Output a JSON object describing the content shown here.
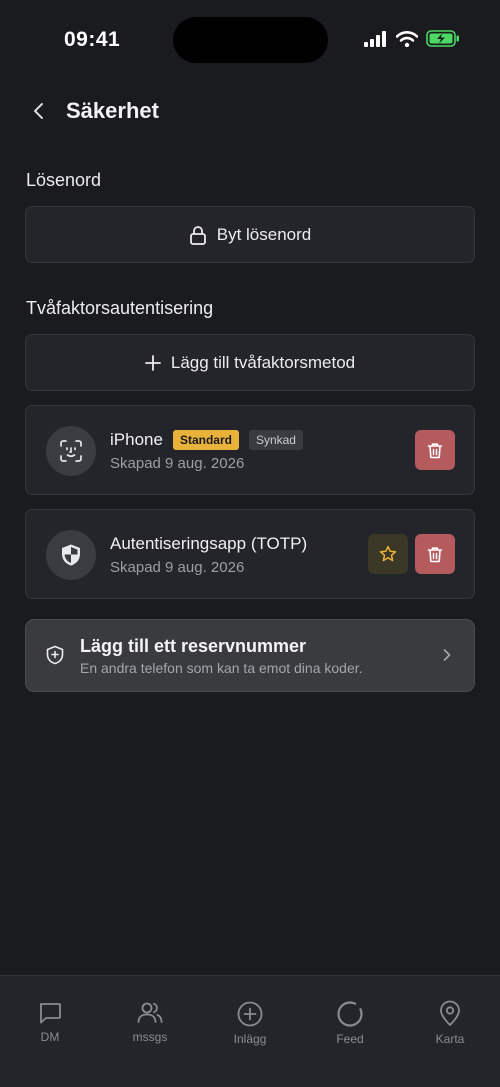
{
  "status_bar": {
    "time": "09:41"
  },
  "header": {
    "title": "Säkerhet"
  },
  "password_section": {
    "label": "Lösenord",
    "change_button": "Byt lösenord"
  },
  "two_factor_section": {
    "label": "Tvåfaktorsautentisering",
    "add_button": "Lägg till tvåfaktorsmetod",
    "methods": [
      {
        "name": "iPhone",
        "badge_default": "Standard",
        "badge_sync": "Synkad",
        "created": "Skapad 9 aug. 2026",
        "icon": "face-id-icon"
      },
      {
        "name": "Autentiseringsapp (TOTP)",
        "created": "Skapad 9 aug. 2026",
        "icon": "shield-icon"
      }
    ]
  },
  "backup_number": {
    "title": "Lägg till ett reservnummer",
    "subtitle": "En andra telefon som kan ta emot dina koder."
  },
  "tab_bar": {
    "tabs": [
      {
        "label": "DM",
        "icon": "chat-bubble-icon"
      },
      {
        "label": "mssgs",
        "icon": "users-icon"
      },
      {
        "label": "Inlägg",
        "icon": "plus-circle-icon"
      },
      {
        "label": "Feed",
        "icon": "circle-icon"
      },
      {
        "label": "Karta",
        "icon": "map-pin-icon"
      }
    ]
  },
  "colors": {
    "background": "#1a1b1e",
    "card": "#24252a",
    "badge_standard": "#e9b23a",
    "delete": "#b55a5d",
    "battery": "#4cd964"
  }
}
